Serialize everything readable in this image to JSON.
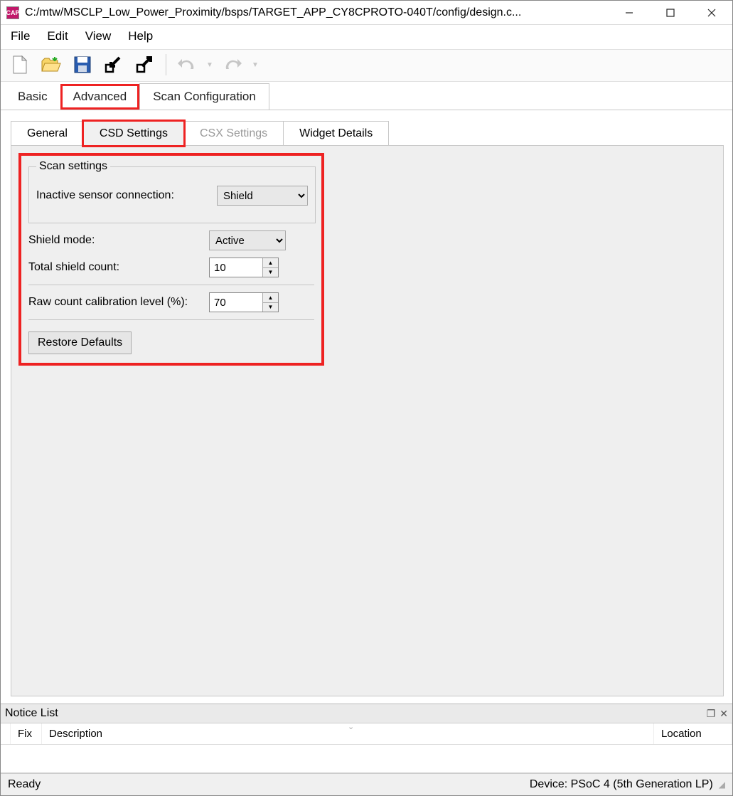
{
  "window": {
    "title": "C:/mtw/MSCLP_Low_Power_Proximity/bsps/TARGET_APP_CY8CPROTO-040T/config/design.c..."
  },
  "menu": {
    "file": "File",
    "edit": "Edit",
    "view": "View",
    "help": "Help"
  },
  "main_tabs": {
    "basic": "Basic",
    "advanced": "Advanced",
    "scan_config": "Scan Configuration"
  },
  "sub_tabs": {
    "general": "General",
    "csd": "CSD Settings",
    "csx": "CSX Settings",
    "widget": "Widget Details"
  },
  "csd": {
    "scan_settings_legend": "Scan settings",
    "inactive_sensor_label": "Inactive sensor connection:",
    "inactive_sensor_value": "Shield",
    "shield_mode_label": "Shield mode:",
    "shield_mode_value": "Active",
    "total_shield_count_label": "Total shield count:",
    "total_shield_count_value": "10",
    "raw_count_label": "Raw count calibration level (%):",
    "raw_count_value": "70",
    "restore_defaults": "Restore Defaults"
  },
  "notice": {
    "panel_title": "Notice List",
    "col_fix": "Fix",
    "col_desc": "Description",
    "col_loc": "Location"
  },
  "status": {
    "ready": "Ready",
    "device": "Device: PSoC 4 (5th Generation LP)"
  }
}
